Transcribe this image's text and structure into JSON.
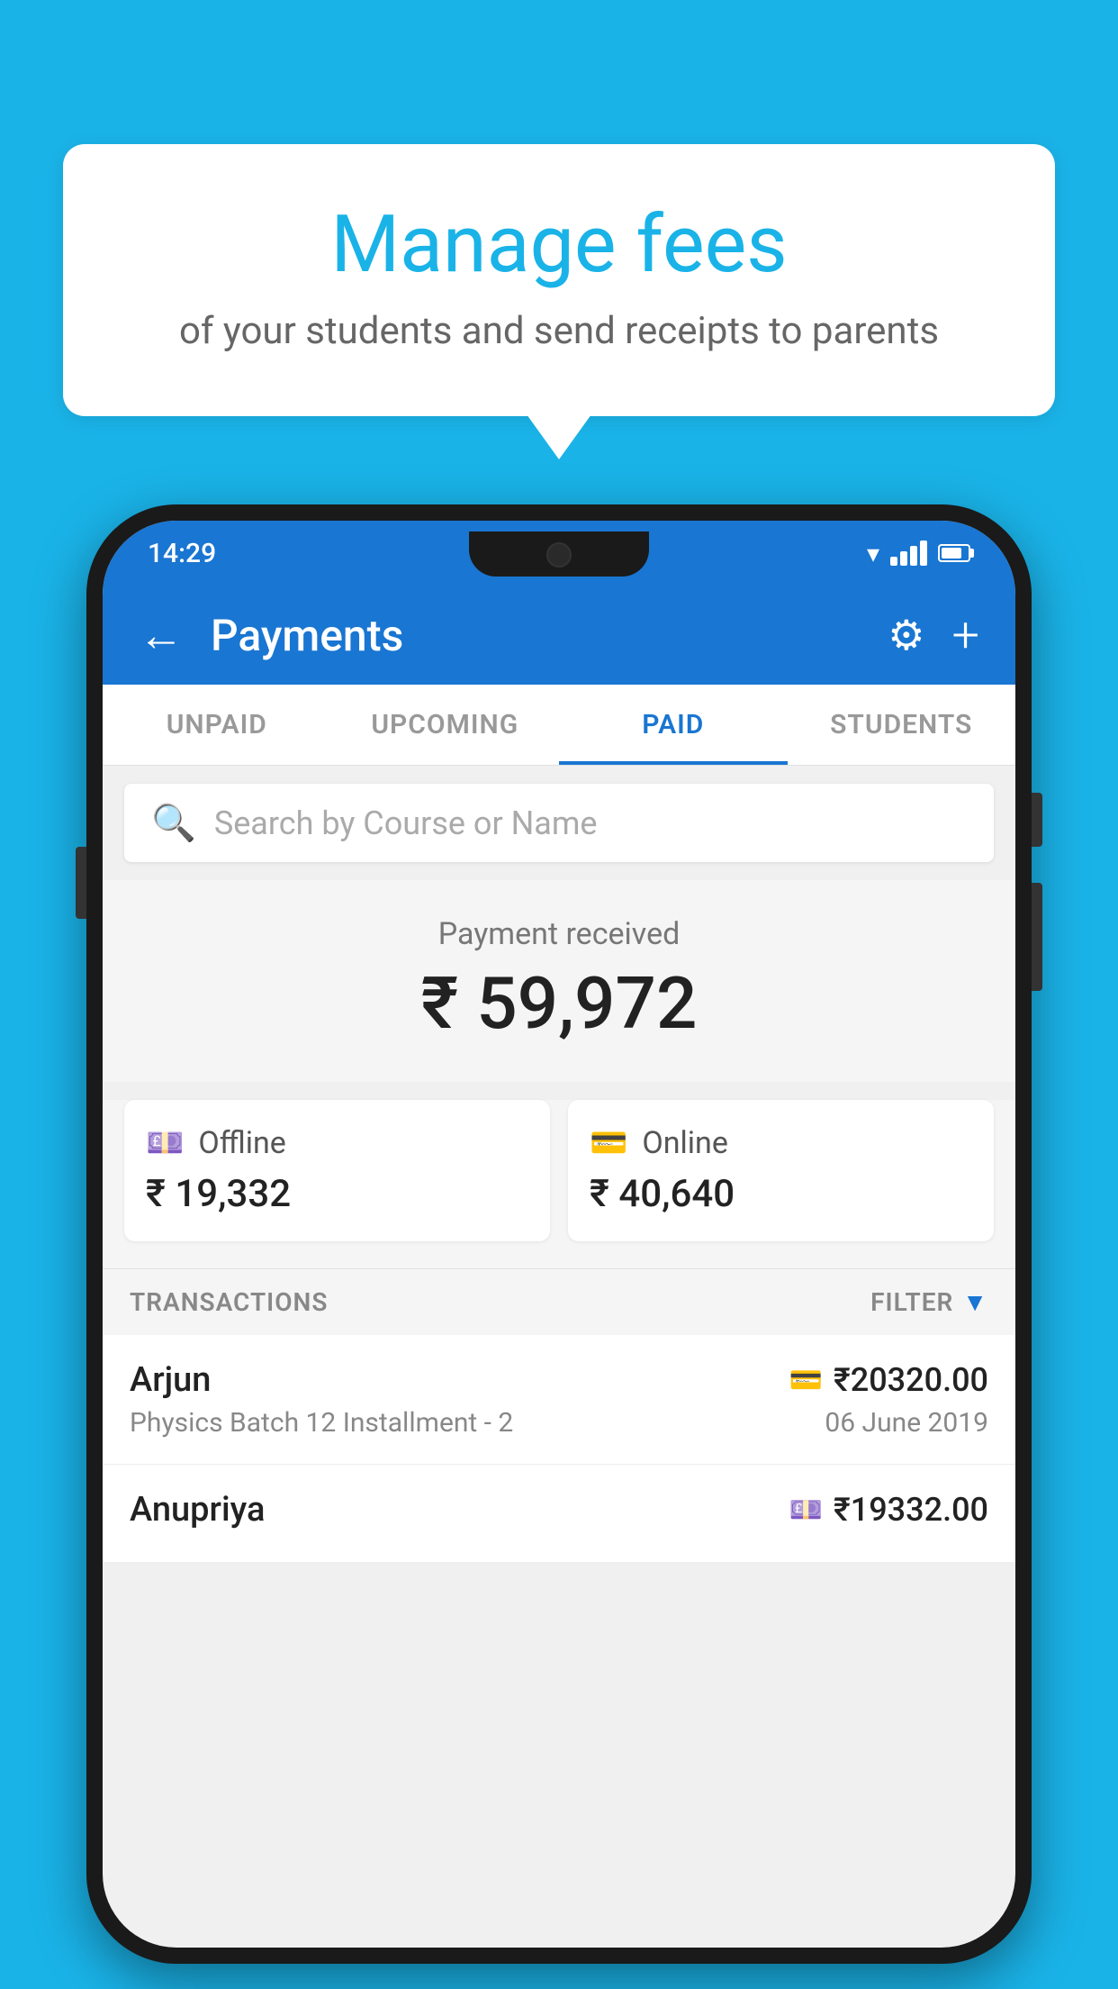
{
  "background_color": "#1ab3e8",
  "speech_bubble": {
    "title": "Manage fees",
    "subtitle": "of your students and send receipts to parents"
  },
  "status_bar": {
    "time": "14:29"
  },
  "app_bar": {
    "title": "Payments",
    "back_label": "←",
    "gear_label": "⚙",
    "plus_label": "+"
  },
  "tabs": [
    {
      "label": "UNPAID",
      "active": false
    },
    {
      "label": "UPCOMING",
      "active": false
    },
    {
      "label": "PAID",
      "active": true
    },
    {
      "label": "STUDENTS",
      "active": false
    }
  ],
  "search": {
    "placeholder": "Search by Course or Name"
  },
  "payment_received": {
    "label": "Payment received",
    "amount": "₹ 59,972"
  },
  "payment_cards": [
    {
      "type": "Offline",
      "amount": "₹ 19,332",
      "icon": "💷"
    },
    {
      "type": "Online",
      "amount": "₹ 40,640",
      "icon": "💳"
    }
  ],
  "transactions_label": "TRANSACTIONS",
  "filter_label": "FILTER",
  "transactions": [
    {
      "name": "Arjun",
      "detail": "Physics Batch 12 Installment - 2",
      "amount": "₹20320.00",
      "date": "06 June 2019",
      "icon": "💳"
    },
    {
      "name": "Anupriya",
      "detail": "",
      "amount": "₹19332.00",
      "date": "",
      "icon": "💷"
    }
  ]
}
